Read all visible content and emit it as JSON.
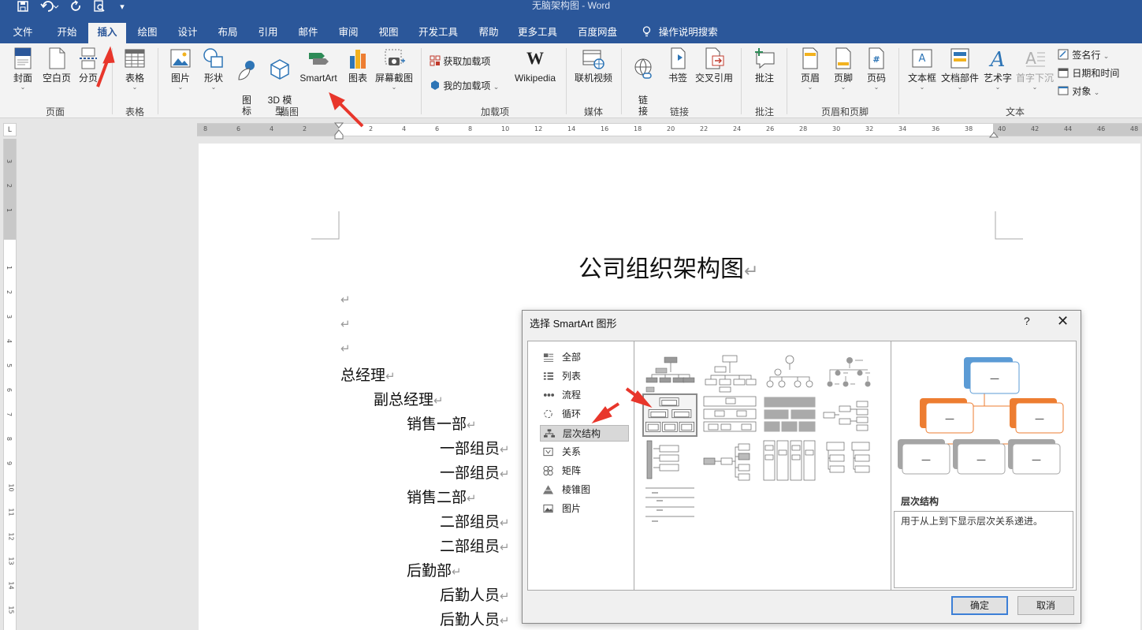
{
  "window": {
    "title": "无脑架构图  -  Word"
  },
  "qat": {
    "save_icon": "save-icon",
    "undo_icon": "undo-icon",
    "redo_icon": "redo-icon",
    "preview_icon": "print-preview-icon",
    "customize": "▾"
  },
  "tabs": [
    "文件",
    "开始",
    "插入",
    "绘图",
    "设计",
    "布局",
    "引用",
    "邮件",
    "审阅",
    "视图",
    "开发工具",
    "帮助",
    "更多工具",
    "百度网盘"
  ],
  "tell_me": "操作说明搜索",
  "ribbon": {
    "pages": {
      "cover": "封面",
      "blank": "空白页",
      "break": "分页",
      "group": "页面"
    },
    "tables": {
      "table": "表格",
      "group": "表格"
    },
    "illustrations": {
      "picture": "图片",
      "shapes": "形状",
      "icons": "图\n标",
      "model3d": "3D 模\n型",
      "smartart": "SmartArt",
      "chart": "图表",
      "screenshot": "屏幕截图",
      "group": "插图"
    },
    "addins": {
      "get": "获取加载项",
      "my": "我的加载项",
      "wiki": "Wikipedia",
      "group": "加载项"
    },
    "media": {
      "video": "联机视频",
      "group": "媒体"
    },
    "links": {
      "link": "链\n接",
      "bookmark": "书签",
      "crossref": "交叉引用",
      "group": "链接"
    },
    "comments": {
      "comment": "批注",
      "group": "批注"
    },
    "header_footer": {
      "header": "页眉",
      "footer": "页脚",
      "page_number": "页码",
      "group": "页眉和页脚"
    },
    "text": {
      "textbox": "文本框",
      "quickparts": "文档部件",
      "wordart": "艺术字",
      "dropcap": "首字下沉",
      "signature": "签名行",
      "datetime": "日期和时间",
      "object": "对象",
      "group": "文本"
    }
  },
  "ruler": {
    "h_ticks": [
      "8",
      "6",
      "4",
      "2",
      "2",
      "4",
      "6",
      "8",
      "10",
      "12",
      "14",
      "16",
      "18",
      "20",
      "22",
      "24",
      "26",
      "28",
      "30",
      "32",
      "34",
      "36",
      "38",
      "40",
      "42",
      "44",
      "46",
      "48"
    ],
    "v_ticks": [
      "3",
      "2",
      "1",
      "1",
      "2",
      "3",
      "4",
      "5",
      "6",
      "7",
      "8",
      "9",
      "10",
      "11",
      "12",
      "13",
      "14",
      "15"
    ],
    "corner": "L"
  },
  "document": {
    "title": "公司组织架构图",
    "mark": "↵",
    "lines": [
      {
        "text": "",
        "level": 0
      },
      {
        "text": "",
        "level": 0
      },
      {
        "text": "",
        "level": 0
      },
      {
        "text": "总经理",
        "level": 0
      },
      {
        "text": "副总经理",
        "level": 1
      },
      {
        "text": "销售一部",
        "level": 2
      },
      {
        "text": "一部组员",
        "level": 3
      },
      {
        "text": "一部组员",
        "level": 3
      },
      {
        "text": "销售二部",
        "level": 2
      },
      {
        "text": "二部组员",
        "level": 3
      },
      {
        "text": "二部组员",
        "level": 3
      },
      {
        "text": "后勤部",
        "level": 2
      },
      {
        "text": "后勤人员",
        "level": 3
      },
      {
        "text": "后勤人员",
        "level": 3
      }
    ]
  },
  "dialog": {
    "title": "选择 SmartArt 图形",
    "help": "?",
    "close": "✕",
    "categories": [
      {
        "label": "全部",
        "icon": "all-icon"
      },
      {
        "label": "列表",
        "icon": "list-icon"
      },
      {
        "label": "流程",
        "icon": "process-icon"
      },
      {
        "label": "循环",
        "icon": "cycle-icon"
      },
      {
        "label": "层次结构",
        "icon": "hierarchy-icon",
        "selected": true
      },
      {
        "label": "关系",
        "icon": "relationship-icon"
      },
      {
        "label": "矩阵",
        "icon": "matrix-icon"
      },
      {
        "label": "棱锥图",
        "icon": "pyramid-icon"
      },
      {
        "label": "图片",
        "icon": "picture-icon"
      }
    ],
    "preview": {
      "name": "层次结构",
      "description": "用于从上到下显示层次关系递进。",
      "box_text": "—"
    },
    "ok": "确定",
    "cancel": "取消"
  },
  "colors": {
    "brand": "#2b579a",
    "annotation_arrow": "#e8362b",
    "preview_top": "#5b9bd5",
    "preview_mid": "#ed7d31",
    "preview_bottom": "#a5a5a5"
  }
}
